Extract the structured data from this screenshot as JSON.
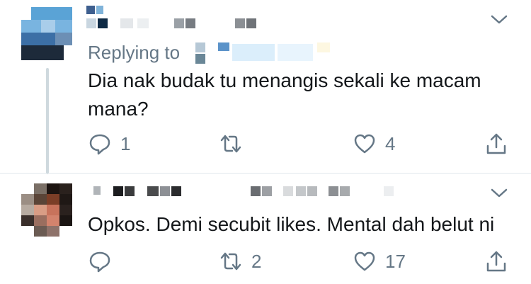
{
  "tweets": [
    {
      "replying_to_label": "Replying to",
      "text": "Dia nak budak tu menangis sekali ke macam\nmana?",
      "reply_count": "1",
      "retweet_count": "",
      "like_count": "4"
    },
    {
      "text": "Opkos. Demi secubit likes. Mental dah belut ni",
      "reply_count": "",
      "retweet_count": "2",
      "like_count": "17"
    }
  ],
  "icons": {
    "reply": "speech-bubble-icon",
    "retweet": "retweet-arrows-icon",
    "like": "heart-icon",
    "share": "share-upload-icon",
    "menu": "chevron-down-icon"
  },
  "colors": {
    "text": "#14171a",
    "muted": "#657786",
    "thread_line": "#cfd9de"
  }
}
